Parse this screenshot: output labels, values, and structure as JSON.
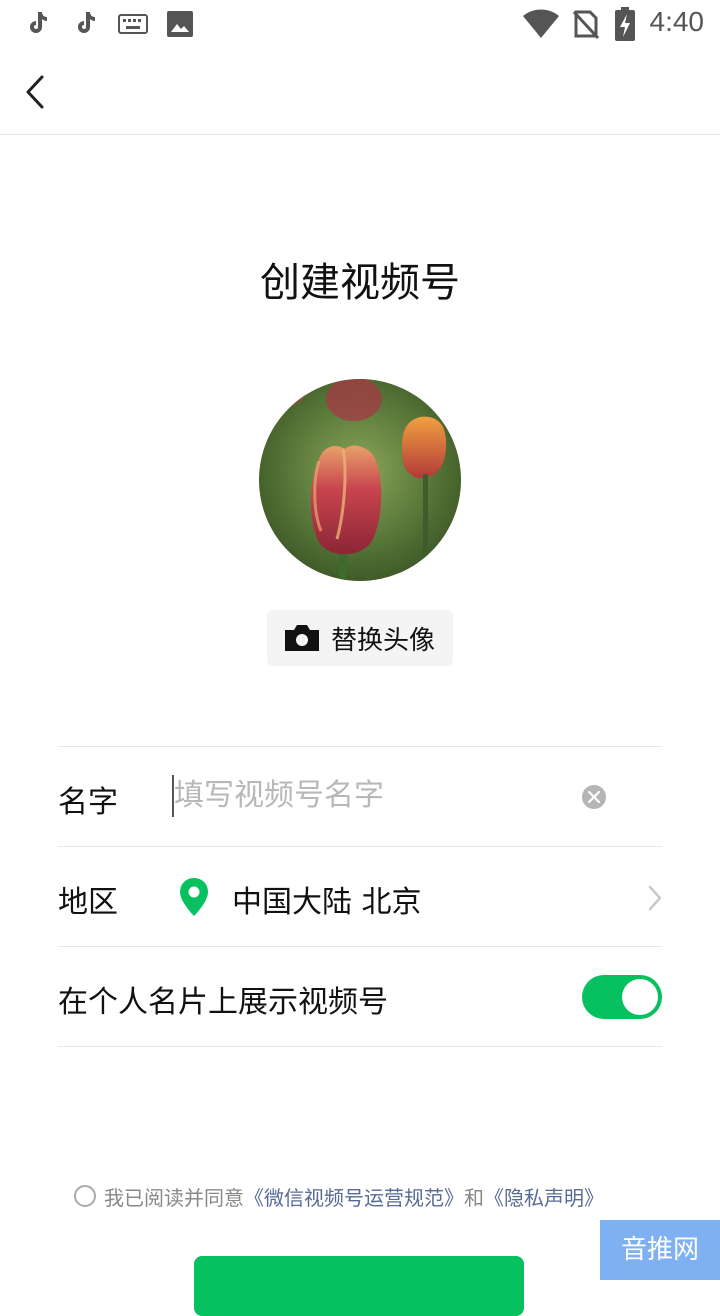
{
  "status_bar": {
    "time": "4:40",
    "icons": [
      "tiktok-icon",
      "tiktok-icon",
      "keyboard-icon",
      "image-icon",
      "wifi-icon",
      "no-sim-icon",
      "battery-charging-icon"
    ]
  },
  "header": {
    "back_icon": "chevron-left-icon"
  },
  "page": {
    "title": "创建视频号"
  },
  "avatar": {
    "change_label": "替换头像",
    "camera_icon": "camera-icon"
  },
  "form": {
    "name": {
      "label": "名字",
      "value": "",
      "placeholder": "填写视频号名字"
    },
    "region": {
      "label": "地区",
      "value": "中国大陆 北京"
    },
    "show_on_card": {
      "label": "在个人名片上展示视频号",
      "enabled": true
    }
  },
  "agreement": {
    "prefix": "我已阅读并同意",
    "link1": "《微信视频号运营规范》",
    "and": "和",
    "link2": "《隐私声明》",
    "checked": false
  },
  "watermark": "音推网",
  "colors": {
    "accent": "#07c160",
    "link": "#576b95"
  }
}
